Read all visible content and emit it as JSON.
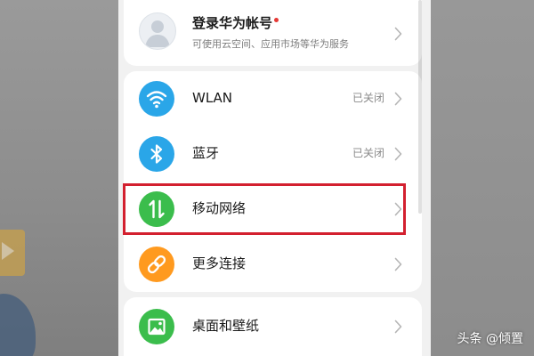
{
  "account": {
    "title": "登录华为帐号",
    "subtitle": "可使用云空间、应用市场等华为服务"
  },
  "network_items": [
    {
      "label": "WLAN",
      "status": "已关闭",
      "icon": "wifi-icon",
      "color": "#2aa6e8"
    },
    {
      "label": "蓝牙",
      "status": "已关闭",
      "icon": "bluetooth-icon",
      "color": "#2aa6e8"
    },
    {
      "label": "移动网络",
      "status": "",
      "icon": "mobile-data-icon",
      "color": "#3bbd4c"
    },
    {
      "label": "更多连接",
      "status": "",
      "icon": "link-icon",
      "color": "#ff9a1f"
    }
  ],
  "desktop_item": {
    "label": "桌面和壁纸",
    "icon": "wallpaper-icon",
    "color": "#3bbd4c"
  },
  "watermark": "头条 @倾置",
  "highlight_color": "#d3202f"
}
